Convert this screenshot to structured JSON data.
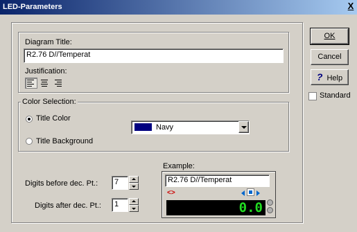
{
  "window": {
    "title": "LED-Parameters",
    "close_label": "X"
  },
  "diagram_title": {
    "label": "Diagram Title:",
    "value": "R2.76 D//Temperat"
  },
  "justification": {
    "label": "Justification:",
    "options": [
      "left",
      "center",
      "right"
    ]
  },
  "color_selection": {
    "label": "Color Selection:",
    "title_color_label": "Title Color",
    "title_background_label": "Title Background",
    "selected": "title_color",
    "color_value": "Navy",
    "color_swatch": "#000080"
  },
  "digits_before": {
    "label": "Digits before dec. Pt.:",
    "value": "7"
  },
  "digits_after": {
    "label": "Digits after dec. Pt.:",
    "value": "1"
  },
  "example": {
    "label": "Example:",
    "title": "R2.76 D//Temperat",
    "marker": "<>",
    "display_value": "0.0"
  },
  "buttons": {
    "ok": "OK",
    "cancel": "Cancel",
    "help": "Help",
    "help_icon": "?"
  },
  "standard": {
    "label": "Standard",
    "checked": false
  }
}
